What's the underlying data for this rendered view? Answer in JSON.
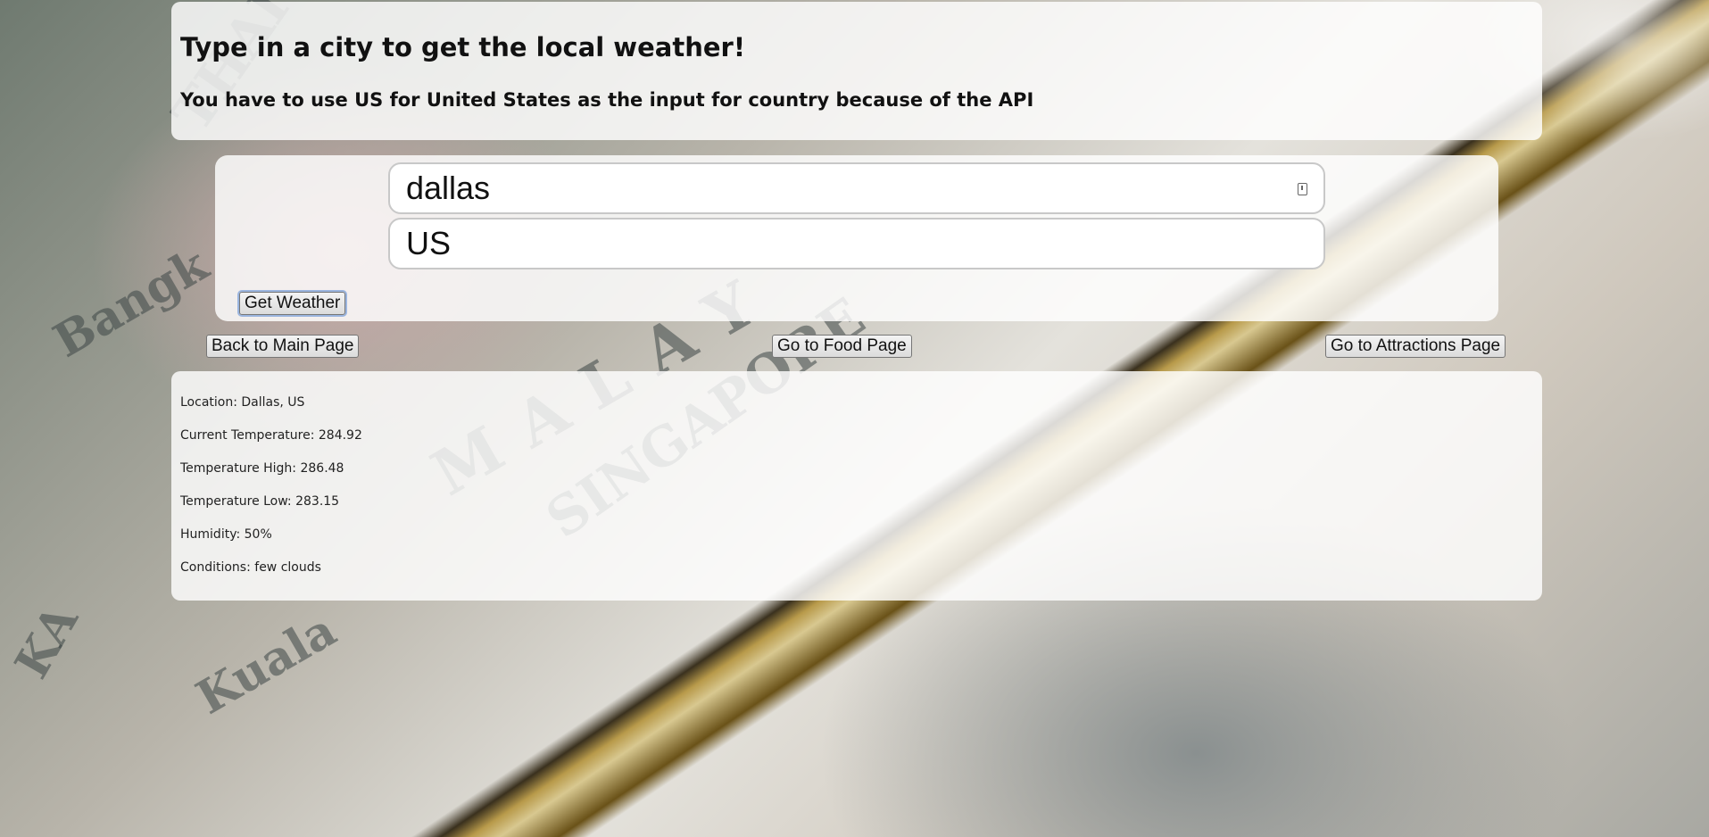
{
  "header": {
    "title": "Type in a city to get the local weather!",
    "subtitle": "You have to use US for United States as the input for country because of the API"
  },
  "form": {
    "city_value": "dallas",
    "country_value": "US",
    "submit_label": "Get Weather"
  },
  "nav": {
    "back_label": "Back to Main Page",
    "food_label": "Go to Food Page",
    "attractions_label": "Go to Attractions Page"
  },
  "results": {
    "location": "Location: Dallas, US",
    "current_temp": "Current Temperature: 284.92",
    "temp_high": "Temperature High: 286.48",
    "temp_low": "Temperature Low: 283.15",
    "humidity": "Humidity: 50%",
    "conditions": "Conditions: few clouds"
  }
}
